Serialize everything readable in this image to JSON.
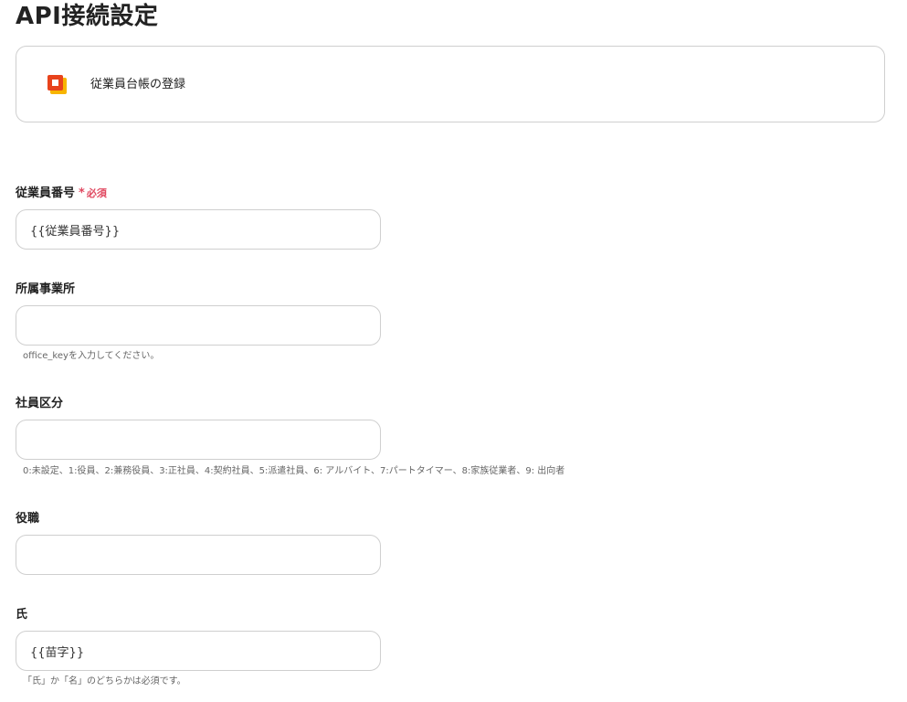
{
  "page": {
    "title": "API接続設定"
  },
  "action": {
    "icon": "app-logo-icon",
    "label": "従業員台帳の登録"
  },
  "fields": [
    {
      "label": "従業員番号",
      "required_mark": "*",
      "required_text": "必須",
      "value": "{{従業員番号}}",
      "help": ""
    },
    {
      "label": "所属事業所",
      "value": "",
      "help": "office_keyを入力してください。"
    },
    {
      "label": "社員区分",
      "value": "",
      "help": "0:未設定、1:役員、2:兼務役員、3:正社員、4:契約社員、5:派遣社員、6: アルバイト、7:パートタイマー、8:家族従業者、9: 出向者"
    },
    {
      "label": "役職",
      "value": "",
      "help": ""
    },
    {
      "label": "氏",
      "value": "{{苗字}}",
      "help": "「氏」か「名」のどちらかは必須です。"
    }
  ],
  "colors": {
    "required": "#e04860",
    "border": "#cfcfcf",
    "icon_orange": "#f08a00",
    "icon_red": "#e8431c"
  }
}
